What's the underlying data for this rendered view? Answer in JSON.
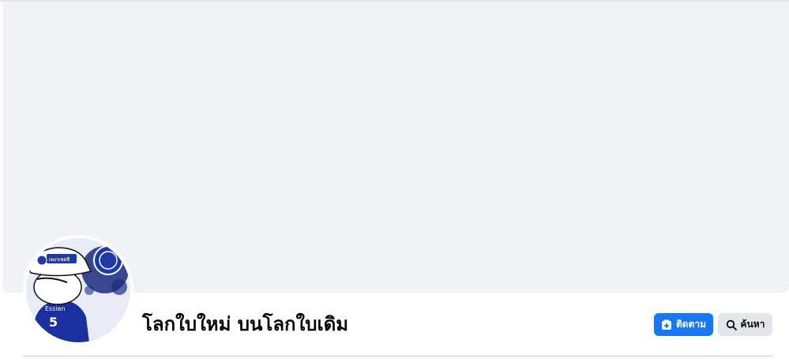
{
  "header": {
    "page_name": "โลกใบใหม่ บนโลกใบเดิม"
  },
  "actions": {
    "follow_label": "ติดตาม",
    "search_label": "ค้นหา"
  },
  "profile_picture": {
    "jersey_name": "Essien",
    "jersey_number": "5",
    "cap_text": "เหงาเชลซี"
  },
  "icons": {
    "follow": "follow-plus-icon",
    "search": "search-icon"
  },
  "colors": {
    "primary_button": "#1877f2",
    "secondary_button": "#e4e6eb",
    "cover_background": "#f0f2f5",
    "text": "#050505"
  }
}
